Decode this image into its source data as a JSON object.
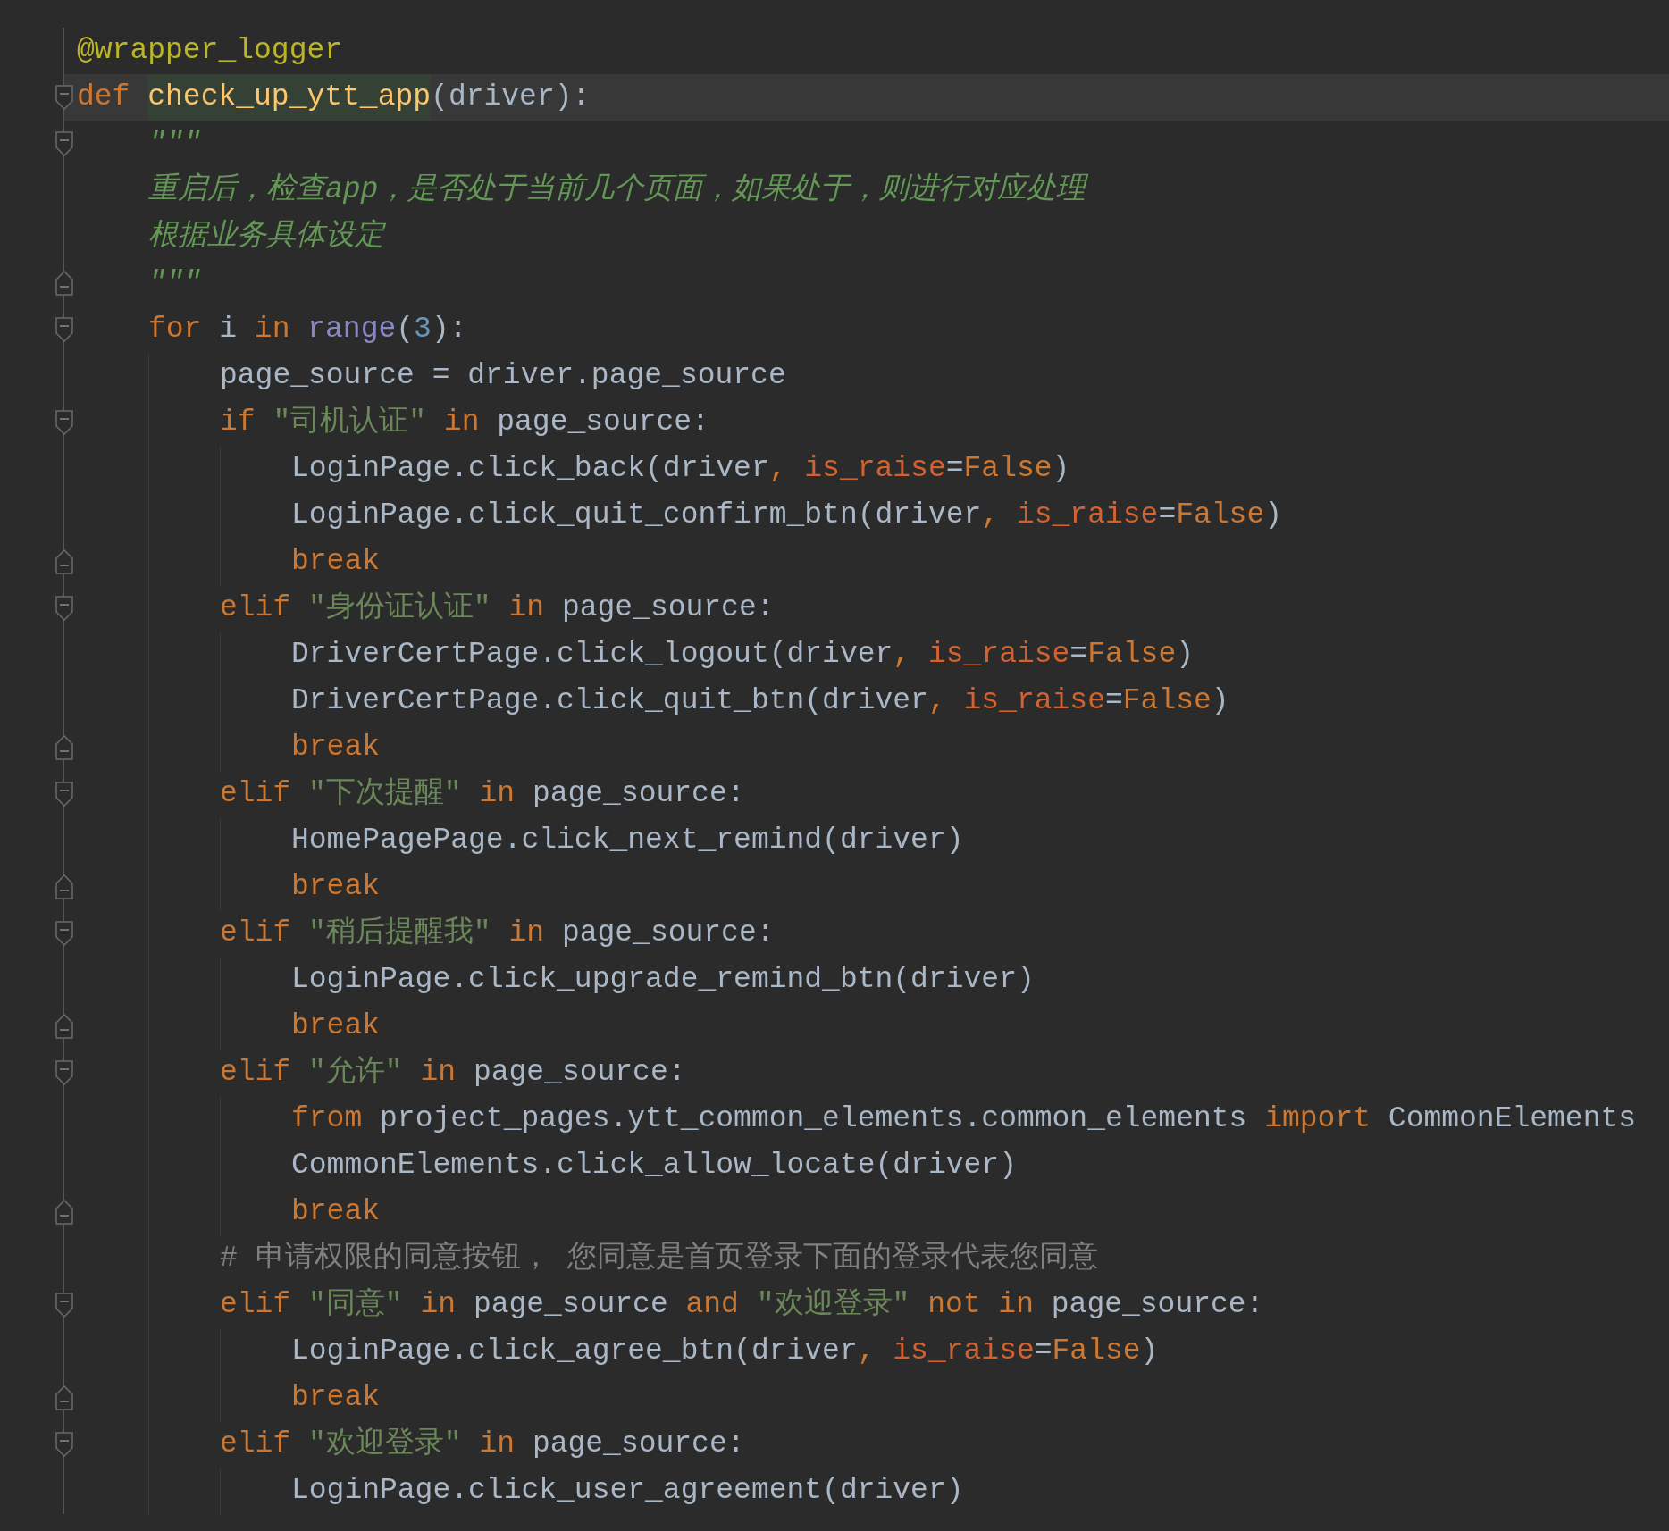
{
  "editor": {
    "lines": [
      {
        "current": false,
        "tokens": [
          {
            "kind": "decorator",
            "text": "@wrapper_logger"
          }
        ]
      },
      {
        "fold_marker": {
          "kind": "open"
        },
        "current": true,
        "tokens": [
          {
            "kind": "keyword",
            "text": "def "
          },
          {
            "kind": "function_decl",
            "text": "check_up_ytt_app"
          },
          {
            "kind": "plain",
            "text": "(driver):"
          }
        ],
        "children": [
          {
            "fold_marker": {
              "kind": "open"
            },
            "current": false,
            "tokens": [
              {
                "kind": "docstring",
                "text": "\"\"\""
              }
            ]
          },
          {
            "current": false,
            "tokens": [
              {
                "kind": "docstring",
                "text": "重启后，检查app，是否处于当前几个页面，如果处于，则进行对应处理"
              }
            ]
          },
          {
            "current": false,
            "tokens": [
              {
                "kind": "docstring",
                "text": "根据业务具体设定"
              }
            ]
          },
          {
            "fold_marker": {
              "kind": "close"
            },
            "current": false,
            "tokens": [
              {
                "kind": "docstring",
                "text": "\"\"\""
              }
            ]
          },
          {
            "fold_marker": {
              "kind": "open"
            },
            "current": false,
            "tokens": [
              {
                "kind": "keyword",
                "text": "for "
              },
              {
                "kind": "plain",
                "text": "i "
              },
              {
                "kind": "keyword",
                "text": "in "
              },
              {
                "kind": "builtin",
                "text": "range"
              },
              {
                "kind": "plain",
                "text": "("
              },
              {
                "kind": "number",
                "text": "3"
              },
              {
                "kind": "plain",
                "text": "):"
              }
            ],
            "children": [
              {
                "current": false,
                "tokens": [
                  {
                    "kind": "plain",
                    "text": "page_source = driver.page_source"
                  }
                ]
              },
              {
                "fold_marker": {
                  "kind": "open"
                },
                "current": false,
                "tokens": [
                  {
                    "kind": "keyword",
                    "text": "if "
                  },
                  {
                    "kind": "string",
                    "text": "\"司机认证\" "
                  },
                  {
                    "kind": "keyword",
                    "text": "in "
                  },
                  {
                    "kind": "plain",
                    "text": "page_source:"
                  }
                ],
                "children": [
                  {
                    "current": false,
                    "tokens": [
                      {
                        "kind": "plain",
                        "text": "LoginPage.click_back(driver"
                      },
                      {
                        "kind": "keyword",
                        "text": ", "
                      },
                      {
                        "kind": "param",
                        "text": "is_raise"
                      },
                      {
                        "kind": "plain",
                        "text": "="
                      },
                      {
                        "kind": "keyword",
                        "text": "False"
                      },
                      {
                        "kind": "plain",
                        "text": ")"
                      }
                    ]
                  },
                  {
                    "current": false,
                    "tokens": [
                      {
                        "kind": "plain",
                        "text": "LoginPage.click_quit_confirm_btn(driver"
                      },
                      {
                        "kind": "keyword",
                        "text": ", "
                      },
                      {
                        "kind": "param",
                        "text": "is_raise"
                      },
                      {
                        "kind": "plain",
                        "text": "="
                      },
                      {
                        "kind": "keyword",
                        "text": "False"
                      },
                      {
                        "kind": "plain",
                        "text": ")"
                      }
                    ]
                  },
                  {
                    "fold_marker": {
                      "kind": "close"
                    },
                    "current": false,
                    "tokens": [
                      {
                        "kind": "keyword",
                        "text": "break"
                      }
                    ]
                  }
                ]
              },
              {
                "fold_marker": {
                  "kind": "open"
                },
                "current": false,
                "tokens": [
                  {
                    "kind": "keyword",
                    "text": "elif "
                  },
                  {
                    "kind": "string",
                    "text": "\"身份证认证\" "
                  },
                  {
                    "kind": "keyword",
                    "text": "in "
                  },
                  {
                    "kind": "plain",
                    "text": "page_source:"
                  }
                ],
                "children": [
                  {
                    "current": false,
                    "tokens": [
                      {
                        "kind": "plain",
                        "text": "DriverCertPage.click_logout(driver"
                      },
                      {
                        "kind": "keyword",
                        "text": ", "
                      },
                      {
                        "kind": "param",
                        "text": "is_raise"
                      },
                      {
                        "kind": "plain",
                        "text": "="
                      },
                      {
                        "kind": "keyword",
                        "text": "False"
                      },
                      {
                        "kind": "plain",
                        "text": ")"
                      }
                    ]
                  },
                  {
                    "current": false,
                    "tokens": [
                      {
                        "kind": "plain",
                        "text": "DriverCertPage.click_quit_btn(driver"
                      },
                      {
                        "kind": "keyword",
                        "text": ", "
                      },
                      {
                        "kind": "param",
                        "text": "is_raise"
                      },
                      {
                        "kind": "plain",
                        "text": "="
                      },
                      {
                        "kind": "keyword",
                        "text": "False"
                      },
                      {
                        "kind": "plain",
                        "text": ")"
                      }
                    ]
                  },
                  {
                    "fold_marker": {
                      "kind": "close"
                    },
                    "current": false,
                    "tokens": [
                      {
                        "kind": "keyword",
                        "text": "break"
                      }
                    ]
                  }
                ]
              },
              {
                "fold_marker": {
                  "kind": "open"
                },
                "current": false,
                "tokens": [
                  {
                    "kind": "keyword",
                    "text": "elif "
                  },
                  {
                    "kind": "string",
                    "text": "\"下次提醒\" "
                  },
                  {
                    "kind": "keyword",
                    "text": "in "
                  },
                  {
                    "kind": "plain",
                    "text": "page_source:"
                  }
                ],
                "children": [
                  {
                    "current": false,
                    "tokens": [
                      {
                        "kind": "plain",
                        "text": "HomePagePage.click_next_remind(driver)"
                      }
                    ]
                  },
                  {
                    "fold_marker": {
                      "kind": "close"
                    },
                    "current": false,
                    "tokens": [
                      {
                        "kind": "keyword",
                        "text": "break"
                      }
                    ]
                  }
                ]
              },
              {
                "fold_marker": {
                  "kind": "open"
                },
                "current": false,
                "tokens": [
                  {
                    "kind": "keyword",
                    "text": "elif "
                  },
                  {
                    "kind": "string",
                    "text": "\"稍后提醒我\" "
                  },
                  {
                    "kind": "keyword",
                    "text": "in "
                  },
                  {
                    "kind": "plain",
                    "text": "page_source:"
                  }
                ],
                "children": [
                  {
                    "current": false,
                    "tokens": [
                      {
                        "kind": "plain",
                        "text": "LoginPage.click_upgrade_remind_btn(driver)"
                      }
                    ]
                  },
                  {
                    "fold_marker": {
                      "kind": "close"
                    },
                    "current": false,
                    "tokens": [
                      {
                        "kind": "keyword",
                        "text": "break"
                      }
                    ]
                  }
                ]
              },
              {
                "fold_marker": {
                  "kind": "open"
                },
                "current": false,
                "tokens": [
                  {
                    "kind": "keyword",
                    "text": "elif "
                  },
                  {
                    "kind": "string",
                    "text": "\"允许\" "
                  },
                  {
                    "kind": "keyword",
                    "text": "in "
                  },
                  {
                    "kind": "plain",
                    "text": "page_source:"
                  }
                ],
                "children": [
                  {
                    "current": false,
                    "tokens": [
                      {
                        "kind": "keyword",
                        "text": "from "
                      },
                      {
                        "kind": "plain",
                        "text": "project_pages.ytt_common_elements.common_elements "
                      },
                      {
                        "kind": "keyword",
                        "text": "import "
                      },
                      {
                        "kind": "plain",
                        "text": "CommonElements"
                      }
                    ]
                  },
                  {
                    "current": false,
                    "tokens": [
                      {
                        "kind": "plain",
                        "text": "CommonElements.click_allow_locate(driver)"
                      }
                    ]
                  },
                  {
                    "fold_marker": {
                      "kind": "close"
                    },
                    "current": false,
                    "tokens": [
                      {
                        "kind": "keyword",
                        "text": "break"
                      }
                    ]
                  }
                ]
              },
              {
                "current": false,
                "tokens": [
                  {
                    "kind": "comment",
                    "text": "# 申请权限的同意按钮， 您同意是首页登录下面的登录代表您同意"
                  }
                ]
              },
              {
                "fold_marker": {
                  "kind": "open"
                },
                "current": false,
                "tokens": [
                  {
                    "kind": "keyword",
                    "text": "elif "
                  },
                  {
                    "kind": "string",
                    "text": "\"同意\" "
                  },
                  {
                    "kind": "keyword",
                    "text": "in "
                  },
                  {
                    "kind": "plain",
                    "text": "page_source "
                  },
                  {
                    "kind": "keyword",
                    "text": "and "
                  },
                  {
                    "kind": "string",
                    "text": "\"欢迎登录\" "
                  },
                  {
                    "kind": "keyword",
                    "text": "not in "
                  },
                  {
                    "kind": "plain",
                    "text": "page_source:"
                  }
                ],
                "children": [
                  {
                    "current": false,
                    "tokens": [
                      {
                        "kind": "plain",
                        "text": "LoginPage.click_agree_btn(driver"
                      },
                      {
                        "kind": "keyword",
                        "text": ", "
                      },
                      {
                        "kind": "param",
                        "text": "is_raise"
                      },
                      {
                        "kind": "plain",
                        "text": "="
                      },
                      {
                        "kind": "keyword",
                        "text": "False"
                      },
                      {
                        "kind": "plain",
                        "text": ")"
                      }
                    ]
                  },
                  {
                    "fold_marker": {
                      "kind": "close"
                    },
                    "current": false,
                    "tokens": [
                      {
                        "kind": "keyword",
                        "text": "break"
                      }
                    ]
                  }
                ]
              },
              {
                "fold_marker": {
                  "kind": "open"
                },
                "current": false,
                "tokens": [
                  {
                    "kind": "keyword",
                    "text": "elif "
                  },
                  {
                    "kind": "string",
                    "text": "\"欢迎登录\" "
                  },
                  {
                    "kind": "keyword",
                    "text": "in "
                  },
                  {
                    "kind": "plain",
                    "text": "page_source:"
                  }
                ],
                "children": [
                  {
                    "current": false,
                    "tokens": [
                      {
                        "kind": "plain",
                        "text": "LoginPage.click_user_agreement(driver)"
                      }
                    ]
                  }
                ]
              }
            ]
          }
        ]
      }
    ]
  }
}
